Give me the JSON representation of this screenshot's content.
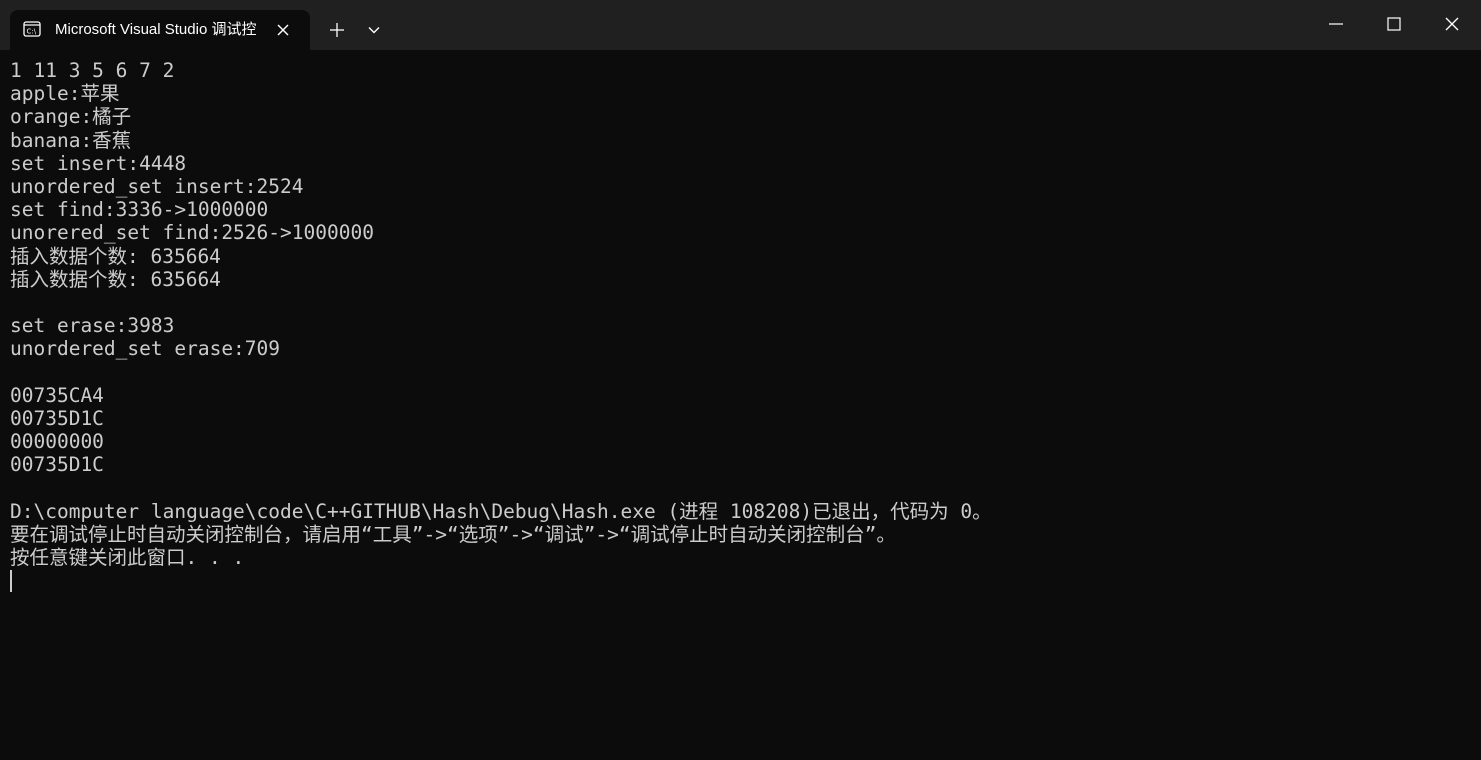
{
  "window": {
    "tab_title": "Microsoft Visual Studio 调试控"
  },
  "icons": {
    "tab_icon": "console-icon",
    "close_tab": "close-icon",
    "new_tab": "plus-icon",
    "dropdown": "chevron-down-icon",
    "minimize": "minimize-icon",
    "maximize": "maximize-icon",
    "close_window": "close-icon"
  },
  "console": {
    "lines": [
      "1 11 3 5 6 7 2",
      "apple:苹果",
      "orange:橘子",
      "banana:香蕉",
      "set insert:4448",
      "unordered_set insert:2524",
      "set find:3336->1000000",
      "unorered_set find:2526->1000000",
      "插入数据个数: 635664",
      "插入数据个数: 635664",
      "",
      "set erase:3983",
      "unordered_set erase:709",
      "",
      "00735CA4",
      "00735D1C",
      "00000000",
      "00735D1C",
      "",
      "D:\\computer language\\code\\C++GITHUB\\Hash\\Debug\\Hash.exe (进程 108208)已退出，代码为 0。",
      "要在调试停止时自动关闭控制台，请启用“工具”->“选项”->“调试”->“调试停止时自动关闭控制台”。",
      "按任意键关闭此窗口. . ."
    ]
  },
  "colors": {
    "titlebar": "#202020",
    "background": "#0c0c0c",
    "text": "#cccccc"
  }
}
